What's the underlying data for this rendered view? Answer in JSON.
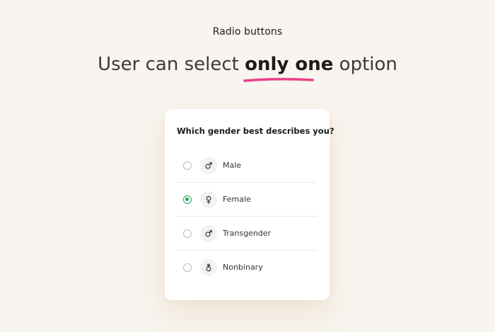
{
  "header": {
    "caption": "Radio buttons",
    "headline_before": "User can select ",
    "headline_bold": "only one",
    "headline_after": " option"
  },
  "card": {
    "question": "Which gender best describes you?",
    "options": [
      {
        "label": "Male",
        "icon": "male-icon",
        "selected": false
      },
      {
        "label": "Female",
        "icon": "female-icon",
        "selected": true
      },
      {
        "label": "Transgender",
        "icon": "male-icon",
        "selected": false
      },
      {
        "label": "Nonbinary",
        "icon": "nonbinary-icon",
        "selected": false
      }
    ]
  },
  "colors": {
    "background": "#f8f4ef",
    "accent_underline": "#ea3f8a",
    "selected_radio": "#29a05a"
  }
}
